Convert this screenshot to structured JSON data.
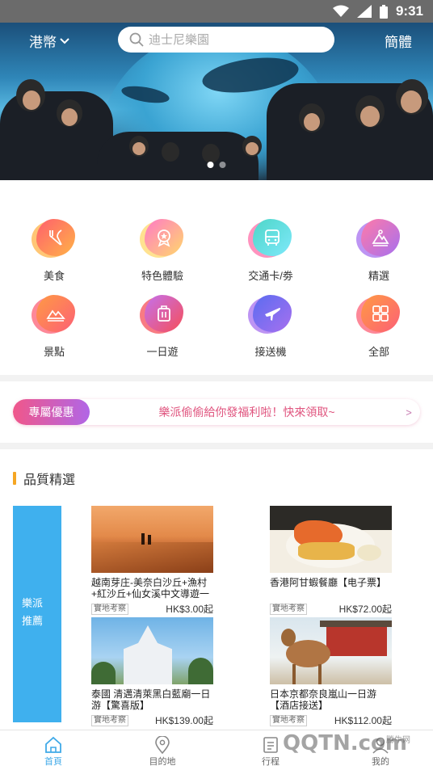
{
  "status_bar": {
    "time": "9:31",
    "icons": [
      "wifi-icon",
      "signal-icon",
      "battery-icon"
    ]
  },
  "header": {
    "currency": "港幣",
    "search_placeholder": "迪士尼樂園",
    "language": "簡體"
  },
  "banner": {
    "dots": 2,
    "active_dot": 1
  },
  "categories": [
    {
      "label": "美食",
      "icon": "food-icon",
      "colors": [
        "#ff5f6d",
        "#ffb347"
      ]
    },
    {
      "label": "特色體驗",
      "icon": "experience-badge-icon",
      "colors": [
        "#ff7ac6",
        "#ffd86b"
      ]
    },
    {
      "label": "交通卡/劵",
      "icon": "bus-icon",
      "colors": [
        "#ff6fa8",
        "#4dd6c8"
      ]
    },
    {
      "label": "精選",
      "icon": "mountain-icon",
      "colors": [
        "#ff7aa8",
        "#a770ef"
      ]
    },
    {
      "label": "景點",
      "icon": "landscape-icon",
      "colors": [
        "#ff9a44",
        "#fc6076"
      ]
    },
    {
      "label": "一日遊",
      "icon": "luggage-icon",
      "colors": [
        "#c471ed",
        "#f64f59"
      ]
    },
    {
      "label": "接送機",
      "icon": "airplane-icon",
      "colors": [
        "#5b6cf0",
        "#a770ef"
      ]
    },
    {
      "label": "全部",
      "icon": "grid-icon",
      "colors": [
        "#ff9a44",
        "#fc6076"
      ]
    }
  ],
  "promo": {
    "tag": "專屬優惠",
    "text": "樂派偷偷給你發福利啦！快來領取~",
    "arrow": ">"
  },
  "quality": {
    "title": "品質精選",
    "side_label_1": "樂派",
    "side_label_2": "推薦",
    "products": [
      {
        "title": "越南芽庄-美奈白沙丘+漁村+紅沙丘+仙女溪中文導遊一",
        "tag": "實地考察",
        "price": "HK$3.00起"
      },
      {
        "title": "香港阿甘蝦餐廳【电子票】",
        "tag": "實地考察",
        "price": "HK$72.00起"
      },
      {
        "title": "泰國 清邁清萊黑白藍廟一日游【驚喜版】",
        "tag": "實地考察",
        "price": "HK$139.00起"
      },
      {
        "title": "日本京都奈良嵐山一日游【酒店接送】",
        "tag": "實地考察",
        "price": "HK$112.00起"
      }
    ]
  },
  "bottom_nav": [
    {
      "label": "首頁",
      "icon": "home-icon",
      "active": true
    },
    {
      "label": "目的地",
      "icon": "location-pin-icon",
      "active": false
    },
    {
      "label": "行程",
      "icon": "itinerary-icon",
      "active": false
    },
    {
      "label": "我的",
      "icon": "profile-icon",
      "active": false
    }
  ],
  "watermark": {
    "text": "QQTN.com",
    "small": "腾牛网"
  },
  "colors": {
    "accent": "#3fa9e8",
    "promo_pink": "#e0557f",
    "side_panel": "#3fb0ee",
    "title_bar": "#f5a623"
  }
}
